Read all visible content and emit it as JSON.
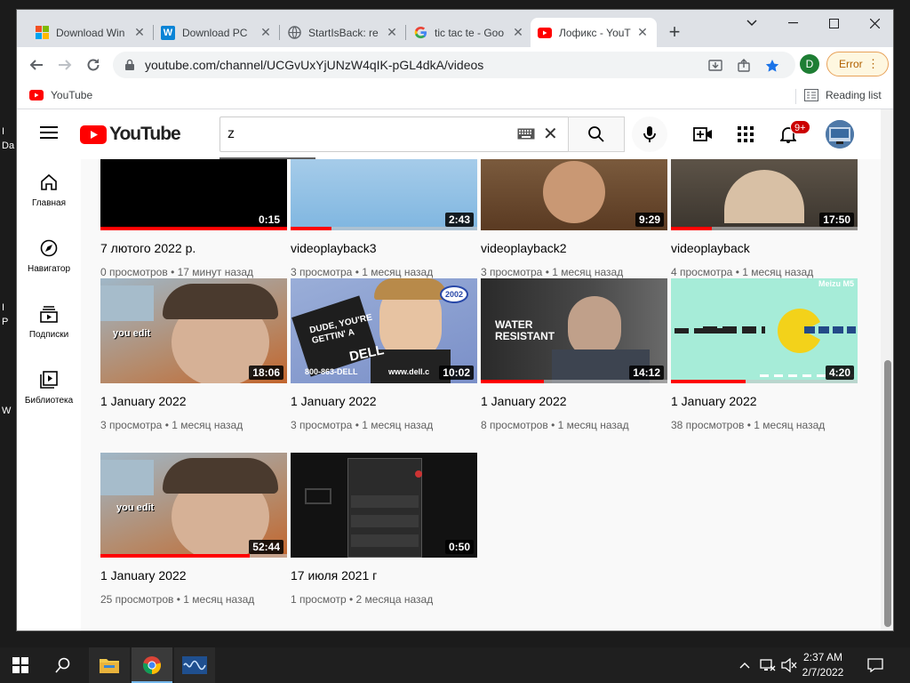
{
  "desktop": {
    "fragments": [
      "I",
      "Da",
      "I",
      "P",
      "W"
    ]
  },
  "browser": {
    "tabs": [
      {
        "title": "Download Win",
        "favicon": "windows-icon"
      },
      {
        "title": "Download PC",
        "favicon": "w-icon"
      },
      {
        "title": "StartIsBack: re",
        "favicon": "globe-icon"
      },
      {
        "title": "tic tac te - Goo",
        "favicon": "google-icon"
      },
      {
        "title": "Лофикс - YouT",
        "favicon": "youtube-icon"
      }
    ],
    "url": "youtube.com/channel/UCGvUxYjUNzW4qIK-pGL4dkA/videos",
    "profile_initial": "D",
    "error_label": "Error",
    "bookmark": "YouTube",
    "reading_list": "Reading list"
  },
  "youtube": {
    "logo_text": "YouTube",
    "search_value": "z",
    "notification_count": "9+",
    "sidebar": [
      {
        "label": "Главная",
        "icon": "home-icon"
      },
      {
        "label": "Навигатор",
        "icon": "compass-icon"
      },
      {
        "label": "Подписки",
        "icon": "subscriptions-icon"
      },
      {
        "label": "Библиотека",
        "icon": "library-icon"
      }
    ],
    "videos": [
      {
        "title": "7 лютого 2022 р.",
        "meta": "0 просмотров • 17 минут назад",
        "duration": "0:15",
        "progress": 1.0
      },
      {
        "title": "videoplayback3",
        "meta": "3 просмотра • 1 месяц назад",
        "duration": "2:43",
        "progress": 0.22
      },
      {
        "title": "videoplayback2",
        "meta": "3 просмотра • 1 месяц назад",
        "duration": "9:29",
        "progress": 0.0
      },
      {
        "title": "videoplayback",
        "meta": "4 просмотра • 1 месяц назад",
        "duration": "17:50",
        "progress": 0.22
      },
      {
        "title": "1 January 2022",
        "meta": "3 просмотра • 1 месяц назад",
        "duration": "18:06",
        "progress": 0.0
      },
      {
        "title": "1 January 2022",
        "meta": "3 просмотра • 1 месяц назад",
        "duration": "10:02",
        "progress": 0.0
      },
      {
        "title": "1 January 2022",
        "meta": "8 просмотров • 1 месяц назад",
        "duration": "14:12",
        "progress": 0.34
      },
      {
        "title": "1 January 2022",
        "meta": "38 просмотров • 1 месяц назад",
        "duration": "4:20",
        "progress": 0.4
      },
      {
        "title": "1 January 2022",
        "meta": "25 просмотров • 1 месяц назад",
        "duration": "52:44",
        "progress": 0.8
      },
      {
        "title": "17 июля 2021 г",
        "meta": "1 просмотр • 2 месяца назад",
        "duration": "0:50",
        "progress": 0.0
      }
    ],
    "thumb_text": {
      "you_edit": "you edit",
      "dude": "DUDE, YOU'RE GETTIN' A",
      "dell": "DELL",
      "dell_phone": "800-863-DELL",
      "dell_url": "www.dell.c",
      "year": "2002",
      "water": "WATER RESISTANT",
      "brand": "Meizu M5"
    }
  },
  "taskbar": {
    "time": "2:37 AM",
    "date": "2/7/2022"
  }
}
